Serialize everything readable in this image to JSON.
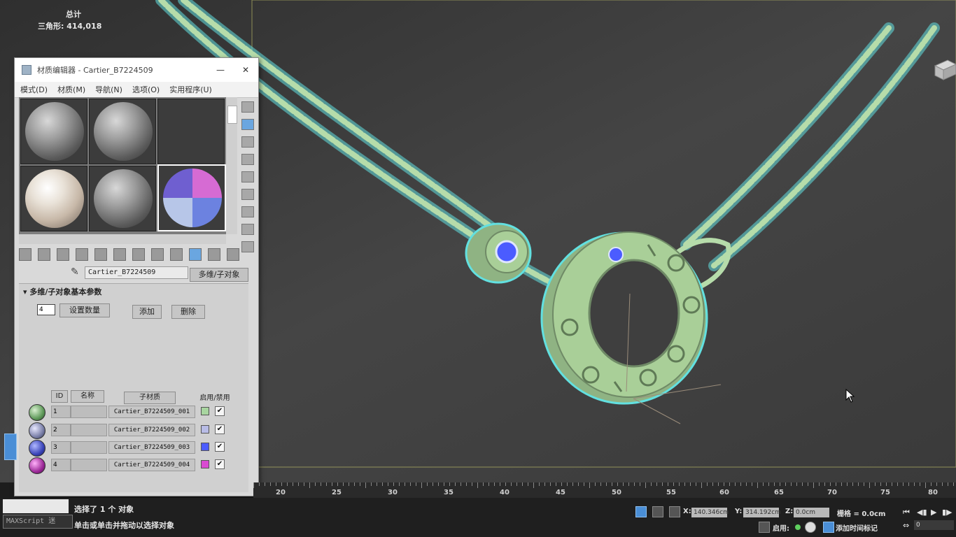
{
  "stats": {
    "total_label": "总计",
    "triangles_label": "三角形:",
    "triangles_value": "414,018"
  },
  "material_editor": {
    "title": "材质编辑器 - Cartier_B7224509",
    "close_glyph": "✕",
    "menu": [
      "模式(D)",
      "材质(M)",
      "导航(N)",
      "选项(O)",
      "实用程序(U)"
    ],
    "current_material": "Cartier_B7224509",
    "material_type_button": "多维/子对象",
    "rollout_title": "多维/子对象基本参数",
    "count_value": "4",
    "set_count_button": "设置数量",
    "add_button": "添加",
    "delete_button": "删除",
    "columns": {
      "id": "ID",
      "name": "名称",
      "sub_material": "子材质",
      "on_off": "启用/禁用"
    },
    "rows": [
      {
        "id": "1",
        "sub": "Cartier_B7224509_001",
        "color": "#a8d5a0",
        "ball": "#5f9a5a",
        "check": "✔"
      },
      {
        "id": "2",
        "sub": "Cartier_B7224509_002",
        "color": "#b8bce6",
        "ball": "#7a7fa8",
        "check": "✔"
      },
      {
        "id": "3",
        "sub": "Cartier_B7224509_003",
        "color": "#4b5cff",
        "ball": "#3a44b8",
        "check": "✔"
      },
      {
        "id": "4",
        "sub": "Cartier_B7224509_004",
        "color": "#d94ad2",
        "ball": "#9c2a98",
        "check": "✔"
      }
    ],
    "slots": [
      "grey-sphere",
      "grey-sphere",
      "empty",
      "rough-white-sphere",
      "grey-sphere",
      "checker-sphere"
    ]
  },
  "timeline": {
    "ticks": [
      "20",
      "25",
      "30",
      "35",
      "40",
      "45",
      "50",
      "55",
      "60",
      "65",
      "70",
      "75",
      "80"
    ]
  },
  "status": {
    "selected": "选择了 1 个 对象",
    "hint": "单击或单击并拖动以选择对象",
    "maxscript": "MAXScript 迷",
    "x_label": "X:",
    "x_value": "140.346cm",
    "y_label": "Y:",
    "y_value": "314.192cm",
    "z_label": "Z:",
    "z_value": "0.0cm",
    "grid": "栅格 = 0.0cm",
    "enable_label": "启用:",
    "add_time_tag": "添加时间标记",
    "frame_value": "0"
  },
  "colors": {
    "chain": "#b6dcaa",
    "chain_outline": "#62e0e0",
    "ring": "#a9cf98",
    "gem": "#4b5cff",
    "viewport_bg": "#3e3e3e"
  }
}
